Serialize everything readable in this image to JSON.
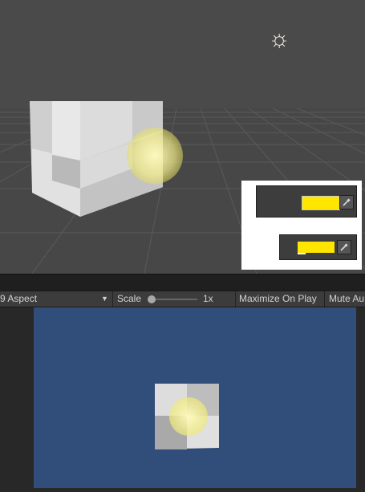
{
  "toolbar": {
    "aspect_label": "9 Aspect",
    "scale_label": "Scale",
    "scale_value": "1x",
    "scale_slider_fraction": 0.05,
    "maximize_label": "Maximize On Play",
    "mute_label": "Mute Au"
  },
  "icons": {
    "sun": "directional-light-icon",
    "dropdown": "chevron-down-icon",
    "eyedropper": "eyedropper-icon"
  },
  "colors": {
    "scene_background": "#484848",
    "game_background": "#314d79",
    "swatch_color": "#ffe600",
    "light_glow": "#fff8a0"
  }
}
